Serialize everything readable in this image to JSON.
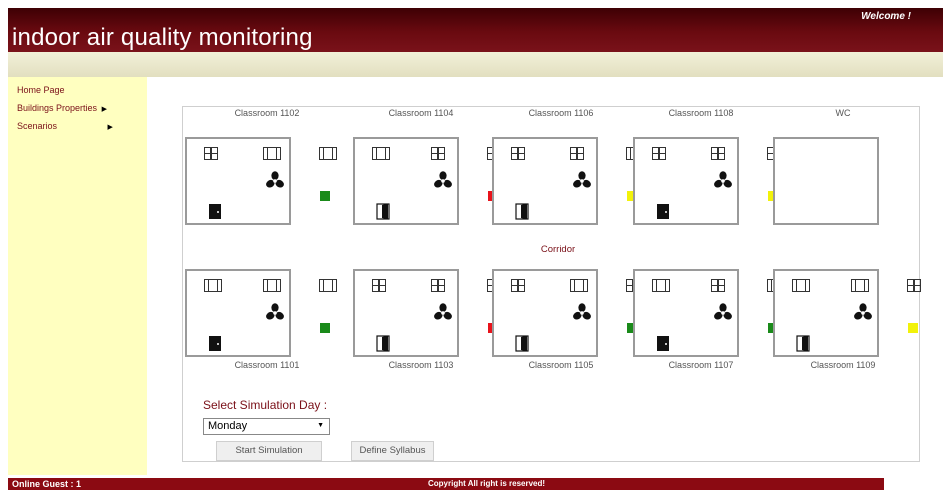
{
  "header": {
    "title": "indoor air quality monitoring",
    "welcome": "Welcome !"
  },
  "sidebar": {
    "items": [
      {
        "label": "Home Page",
        "arrow": ""
      },
      {
        "label": "Buildings Properties",
        "arrow": "▶"
      },
      {
        "label": "Scenarios",
        "arrow": "▶"
      }
    ]
  },
  "floorplan": {
    "corridor_label": "Corridor",
    "colors": {
      "green": "#1a8a1a",
      "red": "#e8131b",
      "yellow": "#f2f20a"
    },
    "top_rooms": [
      {
        "label": "Classroom 1102",
        "indicator": "green",
        "door": "closed",
        "windows": [
          "grid",
          "sash",
          "sash"
        ]
      },
      {
        "label": "Classroom 1104",
        "indicator": "red",
        "door": "open",
        "windows": [
          "sash",
          "grid",
          "grid"
        ]
      },
      {
        "label": "Classroom 1106",
        "indicator": "yellow",
        "door": "open",
        "windows": [
          "grid",
          "grid",
          "sash"
        ]
      },
      {
        "label": "Classroom 1108",
        "indicator": "yellow",
        "door": "closed",
        "windows": [
          "grid",
          "grid",
          "grid"
        ]
      },
      {
        "label": "WC"
      }
    ],
    "bottom_rooms": [
      {
        "label": "Classroom 1101",
        "indicator": "green",
        "door": "closed",
        "windows": [
          "sash",
          "sash",
          "sash"
        ]
      },
      {
        "label": "Classroom 1103",
        "indicator": "red",
        "door": "open",
        "windows": [
          "grid",
          "grid",
          "grid"
        ]
      },
      {
        "label": "Classroom 1105",
        "indicator": "green",
        "door": "open",
        "windows": [
          "grid",
          "sash",
          "grid"
        ]
      },
      {
        "label": "Classroom 1107",
        "indicator": "green",
        "door": "closed",
        "windows": [
          "sash",
          "grid",
          "sash"
        ]
      },
      {
        "label": "Classroom 1109",
        "indicator": "yellow",
        "door": "open",
        "windows": [
          "sash",
          "sash",
          "grid"
        ]
      }
    ]
  },
  "simulation": {
    "label": "Select Simulation Day :",
    "selected_day": "Monday",
    "start_button": "Start Simulation",
    "syllabus_button": "Define Syllabus"
  },
  "footer": {
    "guest": "Online Guest : 1",
    "copyright": "Copyright All right is reserved!"
  }
}
